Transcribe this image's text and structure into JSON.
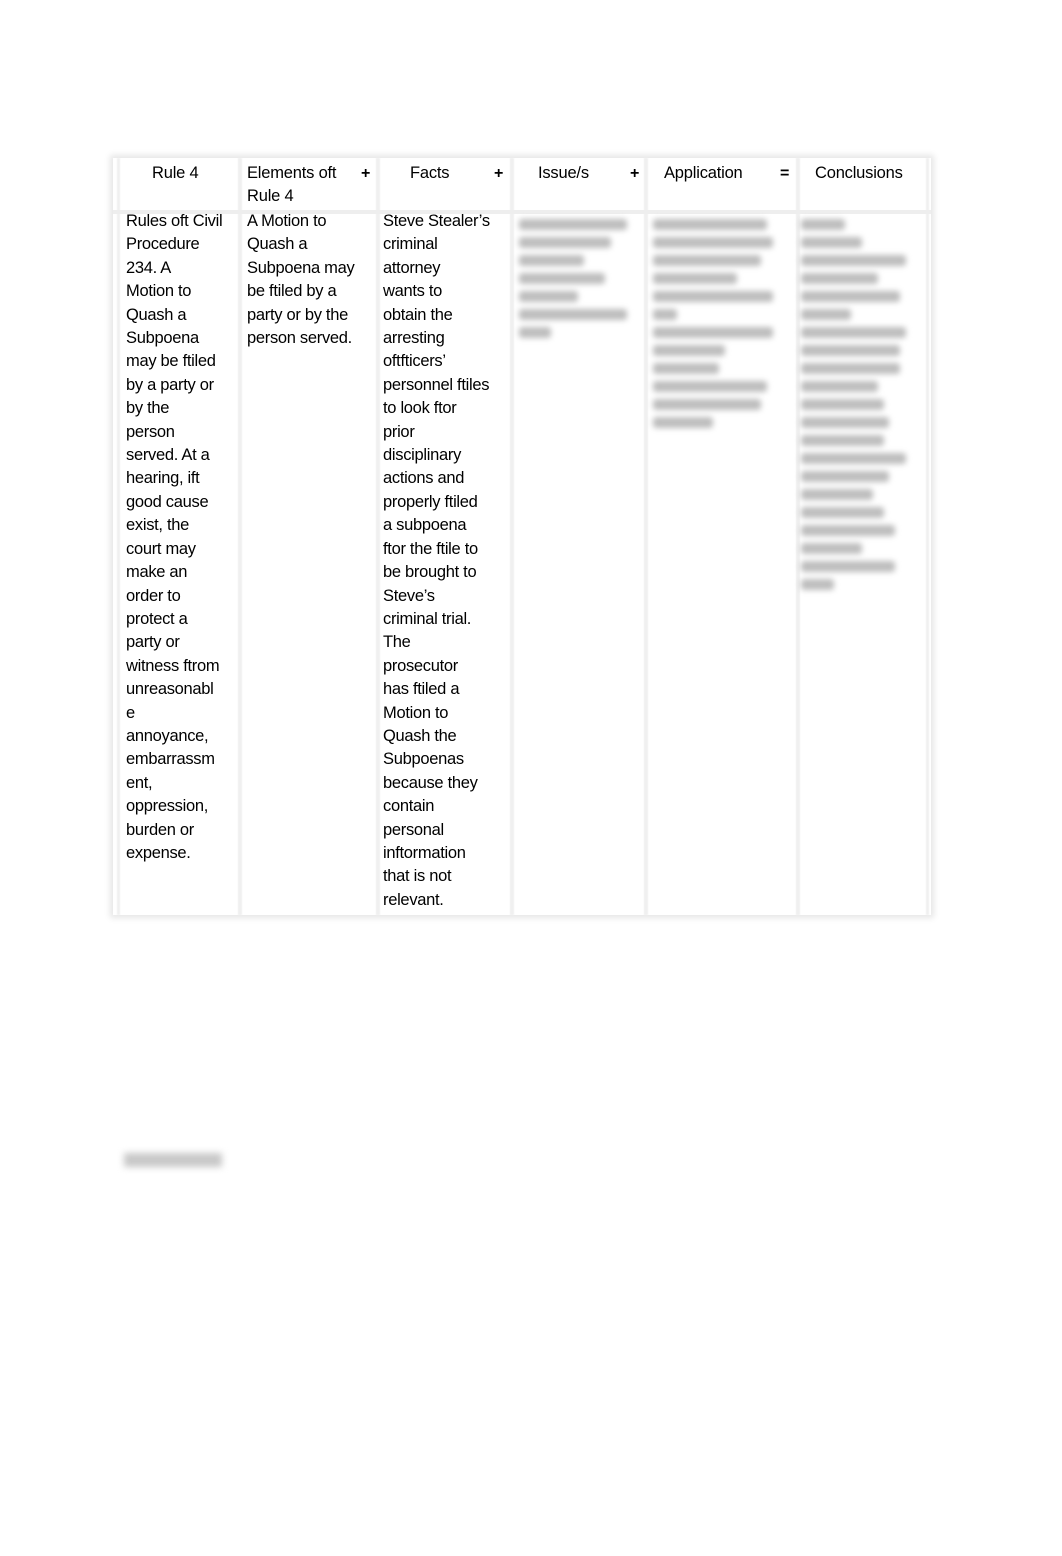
{
  "table": {
    "headers": [
      "Rule 4",
      "Elements oft\nRule 4",
      "Facts",
      "Issue/s",
      "Application",
      "Conclusions"
    ],
    "operators": [
      "+",
      "+",
      "+",
      "="
    ],
    "cells": [
      "Rules oft Civil\nProcedure\n234.  A\nMotion to\nQuash a\nSubpoena\nmay be ftiled\nby a party or\nby the\nperson\nserved. At a\nhearing, ift\ngood cause\nexist, the\ncourt may\nmake an\norder to\nprotect a\nparty or\nwitness ftrom\nunreasonabl\ne\nannoyance,\nembarrassm\nent,\noppression,\nburden or\nexpense.",
      "A Motion to\nQuash a\nSubpoena may\nbe ftiled by a\nparty or by the\nperson served.",
      "Steve Stealer’s\ncriminal\nattorney\nwants to\nobtain the\narresting\noftfticers’\npersonnel ftiles\nto look ftor\nprior\ndisciplinary\nactions and\nproperly ftiled\na subpoena\nftor the ftile to\nbe brought to\nSteve’s\ncriminal trial.\nThe\nprosecutor\nhas ftiled a\nMotion to\nQuash the\nSubpoenas\nbecause they\ncontain\npersonal\ninftormation\nthat is not\nrelevant."
    ],
    "blurred_line_counts": [
      7,
      12,
      21
    ]
  },
  "colors": {
    "text": "#000000",
    "border": "#f0f0f0",
    "blur": "#bdbdbd"
  }
}
